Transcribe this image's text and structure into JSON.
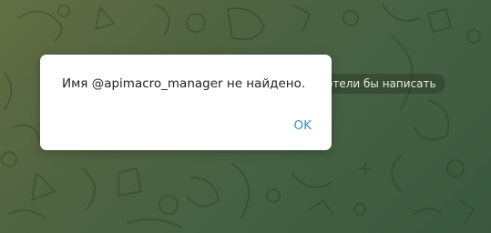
{
  "background": {
    "hint_text": "отели бы написать",
    "colors": {
      "top_left": "#6f7a4a",
      "middle": "#586c48",
      "bottom_right": "#416046"
    }
  },
  "dialog": {
    "message": "Имя @apimacro_manager не найдено.",
    "ok_label": "OK",
    "ok_color": "#3a8ccf"
  }
}
